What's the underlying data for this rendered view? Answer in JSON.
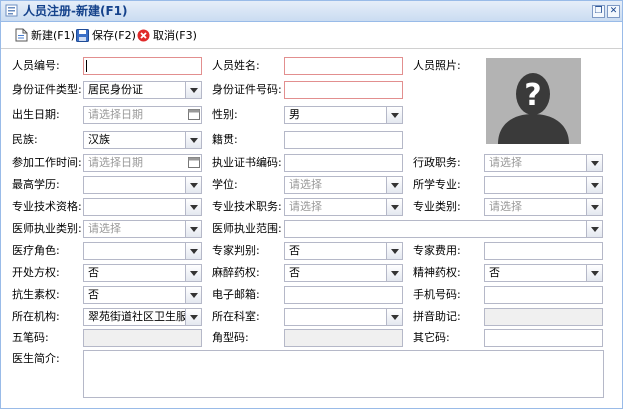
{
  "window": {
    "title": "人员注册-新建(F1)"
  },
  "toolbar": {
    "new": "新建(F1)",
    "save": "保存(F2)",
    "cancel": "取消(F3)"
  },
  "placeholders": {
    "date": "请选择日期",
    "select": "请选择"
  },
  "form": {
    "person_no": {
      "label": "人员编号:",
      "value": ""
    },
    "person_name": {
      "label": "人员姓名:",
      "value": ""
    },
    "person_photo": {
      "label": "人员照片:"
    },
    "id_type": {
      "label": "身份证件类型:",
      "value": "居民身份证"
    },
    "id_no": {
      "label": "身份证件号码:",
      "value": ""
    },
    "birth_date": {
      "label": "出生日期:"
    },
    "gender": {
      "label": "性别:",
      "value": "男"
    },
    "ethnicity": {
      "label": "民族:",
      "value": "汉族"
    },
    "native_place": {
      "label": "籍贯:",
      "value": ""
    },
    "work_start": {
      "label": "参加工作时间:"
    },
    "cert_code": {
      "label": "执业证书编码:",
      "value": ""
    },
    "admin_title": {
      "label": "行政职务:"
    },
    "education": {
      "label": "最高学历:"
    },
    "degree": {
      "label": "学位:"
    },
    "major": {
      "label": "所学专业:"
    },
    "tech_qual": {
      "label": "专业技术资格:"
    },
    "tech_title": {
      "label": "专业技术职务:"
    },
    "pro_category": {
      "label": "专业类别:"
    },
    "practice_category": {
      "label": "医师执业类别:"
    },
    "practice_scope": {
      "label": "医师执业范围:"
    },
    "medical_role": {
      "label": "医疗角色:"
    },
    "expert_flag": {
      "label": "专家判别:",
      "value": "否"
    },
    "expert_fee": {
      "label": "专家费用:"
    },
    "prescribe_right": {
      "label": "开处方权:",
      "value": "否"
    },
    "narcotic_right": {
      "label": "麻醉药权:",
      "value": "否"
    },
    "psych_right": {
      "label": "精神药权:",
      "value": "否"
    },
    "antibiotic_right": {
      "label": "抗生素权:",
      "value": "否"
    },
    "email": {
      "label": "电子邮箱:"
    },
    "phone": {
      "label": "手机号码:"
    },
    "org": {
      "label": "所在机构:",
      "value": "翠苑街道社区卫生服务"
    },
    "dept": {
      "label": "所在科室:"
    },
    "pinyin": {
      "label": "拼音助记:"
    },
    "wubi": {
      "label": "五笔码:"
    },
    "shape_code": {
      "label": "角型码:"
    },
    "other_code": {
      "label": "其它码:"
    },
    "bio": {
      "label": "医生简介:"
    }
  }
}
